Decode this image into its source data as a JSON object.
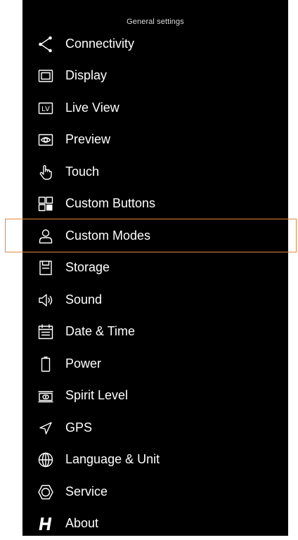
{
  "header": {
    "title": "General settings"
  },
  "menu": {
    "items": [
      {
        "label": "Connectivity",
        "icon": "share-icon"
      },
      {
        "label": "Display",
        "icon": "display-icon"
      },
      {
        "label": "Live View",
        "icon": "live-view-icon"
      },
      {
        "label": "Preview",
        "icon": "eye-icon"
      },
      {
        "label": "Touch",
        "icon": "hand-pointer-icon"
      },
      {
        "label": "Custom Buttons",
        "icon": "grid-buttons-icon"
      },
      {
        "label": "Custom Modes",
        "icon": "user-icon"
      },
      {
        "label": "Storage",
        "icon": "sd-card-icon"
      },
      {
        "label": "Sound",
        "icon": "speaker-icon"
      },
      {
        "label": "Date & Time",
        "icon": "calendar-icon"
      },
      {
        "label": "Power",
        "icon": "battery-icon"
      },
      {
        "label": "Spirit Level",
        "icon": "level-icon"
      },
      {
        "label": "GPS",
        "icon": "location-arrow-icon"
      },
      {
        "label": "Language & Unit",
        "icon": "globe-icon"
      },
      {
        "label": "Service",
        "icon": "hexagon-icon"
      },
      {
        "label": "About",
        "icon": "h-logo-icon"
      }
    ],
    "icon_live_view_text": "LV"
  },
  "theme": {
    "background": "#000000",
    "text": "#ffffff",
    "header_text": "#d8d8d8",
    "highlight_border": "#e3873c"
  }
}
